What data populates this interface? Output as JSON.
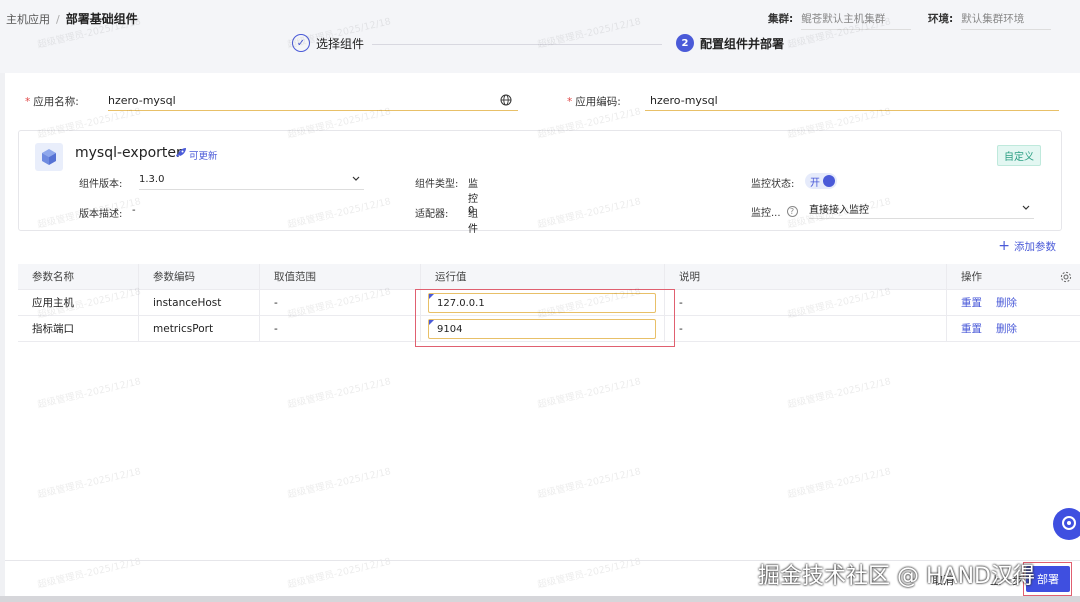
{
  "breadcrumb": {
    "parent": "主机应用",
    "current": "部署基础组件"
  },
  "header": {
    "cluster_label": "集群:",
    "cluster_value": "鲲苍默认主机集群",
    "env_label": "环境:",
    "env_value": "默认集群环境"
  },
  "steps": [
    {
      "number": "✓",
      "label": "选择组件"
    },
    {
      "number": "2",
      "label": "配置组件并部署"
    }
  ],
  "form": {
    "app_name_label": "应用名称:",
    "app_name_value": "hzero-mysql",
    "app_code_label": "应用编码:",
    "app_code_value": "hzero-mysql"
  },
  "component": {
    "name": "mysql-exporter",
    "update_tag": "可更新",
    "custom_tag": "自定义",
    "version_label": "组件版本:",
    "version_value": "1.3.0",
    "desc_label": "版本描述:",
    "desc_value": "-",
    "type_label": "组件类型:",
    "type_value": "监控组件",
    "adapter_label": "适配器:",
    "adapter_value": "0",
    "monitor_status_label": "监控状态:",
    "monitor_status_value": "开",
    "monitor_mode_label": "监控...",
    "monitor_mode_value": "直接接入监控"
  },
  "add_param": "添加参数",
  "table": {
    "headers": [
      "参数名称",
      "参数编码",
      "取值范围",
      "运行值",
      "说明",
      "操作"
    ],
    "rows": [
      {
        "name": "应用主机",
        "code": "instanceHost",
        "range": "-",
        "value": "127.0.0.1",
        "desc": "-",
        "reset": "重置",
        "delete": "删除"
      },
      {
        "name": "指标端口",
        "code": "metricsPort",
        "range": "-",
        "value": "9104",
        "desc": "-",
        "reset": "重置",
        "delete": "删除"
      }
    ]
  },
  "footer": {
    "cancel": "取消",
    "prev": "上一步",
    "deploy": "部署",
    "overlay": "掘金技术社区 @ HAND汉得"
  },
  "watermark": "超级管理员-2025/12/18",
  "colors": {
    "accent": "#4a5ad8",
    "highlight": "#e06070",
    "input_border": "#e8c068"
  }
}
